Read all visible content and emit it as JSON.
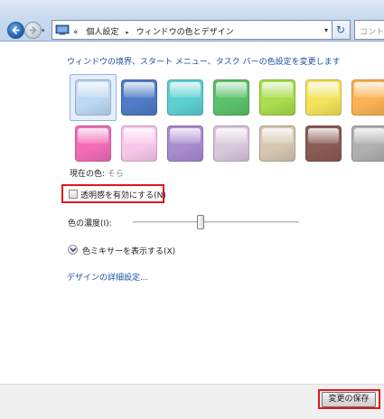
{
  "toolbar": {
    "history_glyph": "▾",
    "address": {
      "prefix": "«",
      "crumb1": "個人設定",
      "crumb2": "ウィンドウの色とデザイン",
      "separator": "▸",
      "dropdown": "▾"
    },
    "refresh_glyph": "↻",
    "search_placeholder": "コントロ"
  },
  "main": {
    "heading": "ウィンドウの境界、スタート メニュー、タスク バーの色設定を変更します",
    "swatches": [
      {
        "name": "sky",
        "color": "#bcd8f3",
        "selected": true
      },
      {
        "name": "twilight",
        "color": "#4f7cc6"
      },
      {
        "name": "sea",
        "color": "#5ecfd0"
      },
      {
        "name": "leaf",
        "color": "#5cc16a"
      },
      {
        "name": "lime",
        "color": "#a9dc4e"
      },
      {
        "name": "lemon",
        "color": "#f3e25a"
      },
      {
        "name": "orange",
        "color": "#fbb254"
      },
      {
        "name": "pink",
        "color": "#f26cb8"
      },
      {
        "name": "blush",
        "color": "#f8c8ea"
      },
      {
        "name": "violet",
        "color": "#a98bd0"
      },
      {
        "name": "lavender",
        "color": "#d8c8dc"
      },
      {
        "name": "taupe",
        "color": "#d5c7b1"
      },
      {
        "name": "chocolate",
        "color": "#8b5b55"
      },
      {
        "name": "slate",
        "color": "#b0b0b0"
      }
    ],
    "current_color_label": "現在の色:",
    "current_color_value": "そら",
    "transparency_label": "透明感を有効にする(N)",
    "transparency_checked": false,
    "intensity_label": "色の濃度(I):",
    "intensity_level": 0.41,
    "mixer_label": "色ミキサーを表示する(X)",
    "advanced_link": "デザインの詳細設定..."
  },
  "footer": {
    "save_button": "変更の保存"
  },
  "colors": {
    "link": "#1e50a2",
    "highlight": "#e0161e"
  }
}
